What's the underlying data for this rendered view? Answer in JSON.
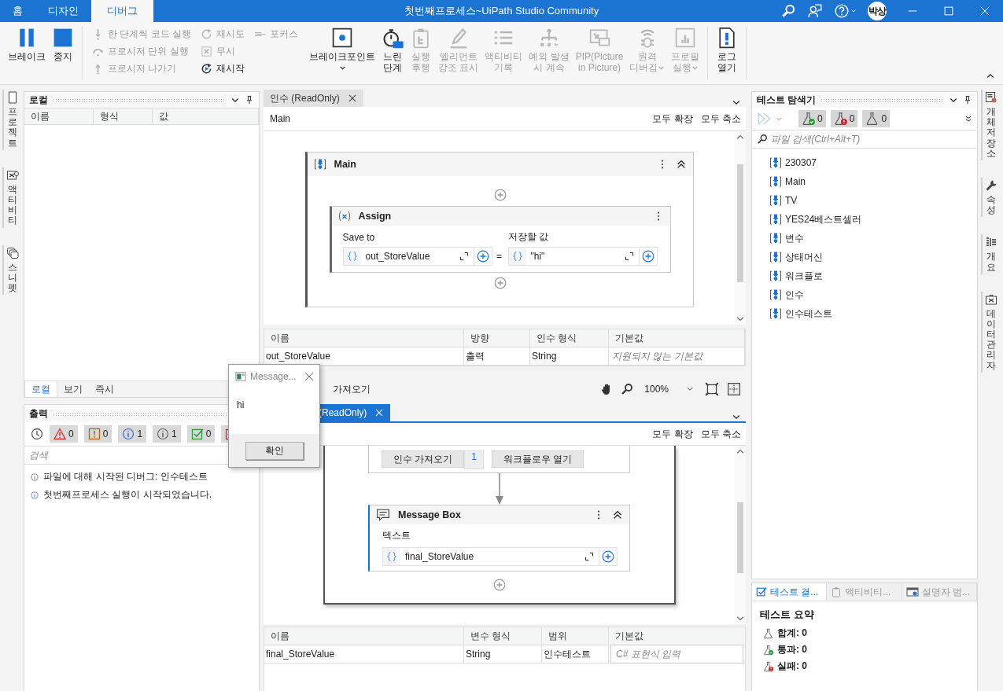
{
  "title_bar": {
    "tabs": [
      {
        "label": "홈",
        "selected": false
      },
      {
        "label": "디자인",
        "selected": false
      },
      {
        "label": "디버그",
        "selected": true
      }
    ],
    "title": "첫번째프로세스~UiPath Studio Community",
    "avatar": "박상"
  },
  "ribbon": {
    "main": [
      {
        "kind": "pause",
        "label": "브레이크",
        "disabled": false
      },
      {
        "kind": "stop",
        "label": "중지",
        "disabled": false
      }
    ],
    "small_columns": [
      [
        {
          "kind": "step-into",
          "label": "한 단계씩 코드 실행",
          "disabled": true
        },
        {
          "kind": "step-over",
          "label": "프로시저 단위 실행",
          "disabled": true
        },
        {
          "kind": "step-out",
          "label": "프로시저 나가기",
          "disabled": true
        }
      ],
      [
        {
          "kind": "retry",
          "label": "재시도",
          "disabled": true
        },
        {
          "kind": "ignore",
          "label": "무시",
          "disabled": true
        },
        {
          "kind": "restart",
          "label": "재시작",
          "disabled": false
        }
      ],
      [
        {
          "kind": "focus",
          "label": "포커스",
          "disabled": true
        }
      ]
    ],
    "large": [
      {
        "kind": "breakpoint",
        "label": "브레이크포인트",
        "disabled": false,
        "dropdown": true
      },
      {
        "kind": "slow-step",
        "label": "느린\n단계",
        "disabled": false
      },
      {
        "kind": "execution-trail",
        "label": "실행\n후행",
        "disabled": true
      },
      {
        "kind": "highlight",
        "label": "엘리먼트\n강조 표시",
        "disabled": true
      },
      {
        "kind": "activity-log",
        "label": "액티비티\n기록",
        "disabled": true
      },
      {
        "kind": "continue-exception",
        "label": "예외 발생\n시 계속",
        "disabled": true
      },
      {
        "kind": "pip",
        "label": "PIP(Picture\nin Picture)",
        "disabled": true
      },
      {
        "kind": "remote-debug",
        "label": "원격\n디버깅",
        "disabled": true,
        "dropdown": true
      },
      {
        "kind": "profile",
        "label": "프로필\n실행",
        "disabled": true,
        "dropdown": true
      }
    ],
    "logs": [
      {
        "kind": "open-log",
        "label": "로그\n열기",
        "disabled": false
      }
    ]
  },
  "left_dock": [
    {
      "kind": "project",
      "label": "프로젝트"
    },
    {
      "kind": "activities",
      "label": "액티비티"
    },
    {
      "kind": "snippets",
      "label": "스니펫"
    }
  ],
  "locals_panel": {
    "title": "로컬",
    "columns": [
      "이름",
      "형식",
      "값"
    ],
    "tabs": [
      {
        "label": "로컬",
        "selected": true
      },
      {
        "label": "보기",
        "selected": false
      },
      {
        "label": "즉시",
        "selected": false
      }
    ]
  },
  "output_panel": {
    "title": "출력",
    "filters": [
      {
        "kind": "error",
        "count": "0",
        "selected": true
      },
      {
        "kind": "warning",
        "count": "0",
        "selected": true
      },
      {
        "kind": "info",
        "count": "1",
        "selected": true
      },
      {
        "kind": "trace",
        "count": "1",
        "selected": true
      },
      {
        "kind": "success",
        "count": "0",
        "selected": true
      },
      {
        "kind": "failure",
        "selected": true
      }
    ],
    "search": {
      "placeholder": "검색"
    },
    "lines": [
      {
        "kind": "trace",
        "text": "파일에 대해 시작된 디버그: 인수테스트"
      },
      {
        "kind": "info",
        "text": "첫번째프로세스 실행이 시작되었습니다."
      }
    ]
  },
  "arguments_document": {
    "tab": {
      "label": "인수 (ReadOnly)",
      "selected": false
    },
    "breadcrumb": "Main",
    "expand_all": "모두 확장",
    "collapse_all": "모두 축소",
    "sequence": {
      "title": "Main"
    },
    "assign": {
      "title": "Assign",
      "to_label": "Save to",
      "to_value": "out_StoreValue",
      "value_label": "저장할 값",
      "operator": "=",
      "value": "\"hi\""
    },
    "table": {
      "columns": [
        "이름",
        "방향",
        "인수 형식",
        "기본값"
      ],
      "rows": [
        {
          "name": "out_StoreValue",
          "direction": "출력",
          "type": "String",
          "default": "지원되지 않는 기본값"
        }
      ]
    }
  },
  "designer_toolbar": {
    "tab": "가져오기",
    "zoom": "100%"
  },
  "workflow_document": {
    "tab": {
      "label": "(ReadOnly)",
      "selected": true
    },
    "expand_all": "모두 확장",
    "collapse_all": "모두 축소",
    "invoke": {
      "import_button": "인수 가져오기",
      "count": "1",
      "open_button": "워크플로우 열기"
    },
    "message_box": {
      "title": "Message Box",
      "text_label": "텍스트",
      "value": "final_StoreValue"
    },
    "table": {
      "columns": [
        "이름",
        "변수 형식",
        "범위",
        "기본값"
      ],
      "rows": [
        {
          "name": "final_StoreValue",
          "type": "String",
          "scope": "인수테스트",
          "default_placeholder": "C# 표현식 입력"
        }
      ]
    }
  },
  "test_explorer": {
    "title": "테스트 탐색기",
    "counters": [
      {
        "kind": "passed",
        "count": "0"
      },
      {
        "kind": "failed",
        "count": "0"
      },
      {
        "kind": "total",
        "count": "0"
      }
    ],
    "search": {
      "placeholder": "파일 검색(Ctrl+Alt+T)"
    },
    "items": [
      "230307",
      "Main",
      "TV",
      "YES24베스트셀러",
      "변수",
      "상태머신",
      "워크플로",
      "인수",
      "인수테스트"
    ]
  },
  "results_panel": {
    "tabs": [
      {
        "kind": "results",
        "label": "테스트 결...",
        "selected": true
      },
      {
        "kind": "activity",
        "label": "액티비티...",
        "selected": false
      },
      {
        "kind": "descriptor",
        "label": "설명자 범...",
        "selected": false
      }
    ],
    "title": "테스트 요약",
    "lines": [
      {
        "kind": "total",
        "text": "합계: 0"
      },
      {
        "kind": "passed",
        "text": "통과: 0"
      },
      {
        "kind": "failed",
        "text": "실패: 0"
      }
    ]
  },
  "right_dock": [
    {
      "kind": "object-repo",
      "label": "개체 저장소"
    },
    {
      "kind": "properties",
      "label": "속성"
    },
    {
      "kind": "outline",
      "label": "개요"
    },
    {
      "kind": "data-manager",
      "label": "데이터 관리자"
    }
  ],
  "message_dialog": {
    "title": "Message...",
    "text": "hi",
    "ok": "확인"
  }
}
